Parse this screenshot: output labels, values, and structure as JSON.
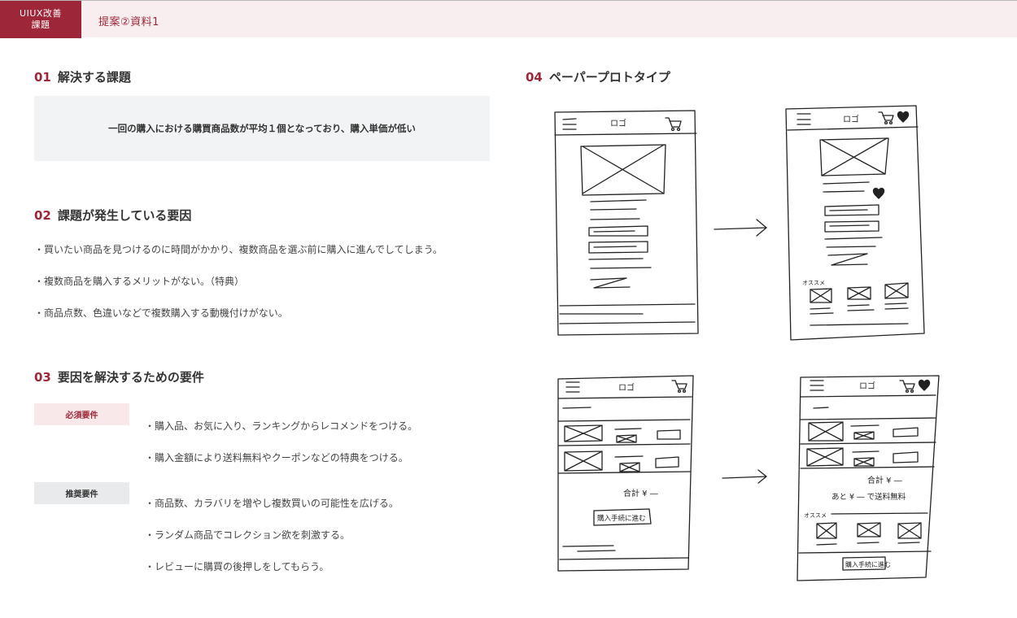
{
  "header": {
    "badge_line1": "UIUX改善",
    "badge_line2": "課題",
    "title": "提案②資料1"
  },
  "sections": {
    "s01": {
      "num": "01",
      "title": "解決する課題",
      "box_text": "一回の購入における購買商品数が平均１個となっており、購入単価が低い"
    },
    "s02": {
      "num": "02",
      "title": "課題が発生している要因",
      "items": [
        "・買いたい商品を見つけるのに時間がかかり、複数商品を選ぶ前に購入に進んでしてしまう。",
        "・複数商品を購入するメリットがない。（特典）",
        "・商品点数、色違いなどで複数購入する動機付けがない。"
      ]
    },
    "s03": {
      "num": "03",
      "title": "要因を解決するための要件",
      "must_label": "必須要件",
      "must_items": [
        "・購入品、お気に入り、ランキングからレコメンドをつける。",
        "・購入金額により送料無料やクーポンなどの特典をつける。"
      ],
      "rec_label": "推奨要件",
      "rec_items": [
        "・商品数、カラバリを増やし複数買いの可能性を広げる。",
        "・ランダム商品でコレクション欲を刺激する。",
        "・レビューに購買の後押しをしてもらう。"
      ]
    },
    "s04": {
      "num": "04",
      "title": "ペーパープロトタイプ"
    }
  },
  "sketch_text": {
    "logo": "ロゴ",
    "osusume": "オススメ",
    "total": "合計 ¥ ―",
    "total2": "合計 ¥ ―",
    "free_ship": "あと ¥ ― で送料無料",
    "buy_btn": "購入手続に進む",
    "buy_btn2": "購入手続に進む"
  },
  "colors": {
    "accent": "#9d2738",
    "header_bg": "#f8eef0",
    "box_bg": "#f2f3f4"
  }
}
